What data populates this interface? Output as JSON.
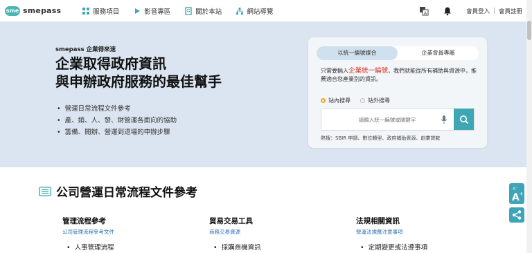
{
  "header": {
    "logo_badge": "sme",
    "logo_text": "smepass",
    "nav": [
      {
        "icon": "grid-icon",
        "label": "服務項目"
      },
      {
        "icon": "play-icon",
        "label": "影音專區"
      },
      {
        "icon": "building-icon",
        "label": "關於本站"
      },
      {
        "icon": "sitemap-icon",
        "label": "網站導覽"
      }
    ],
    "login": "會員登入",
    "register": "會員註冊"
  },
  "hero": {
    "tag": "smepass 企業得來速",
    "title_line1": "企業取得政府資訊",
    "title_line2": "與申辦政府服務的最佳幫手",
    "bullets": [
      "營運日常流程文件參考",
      "產、銷、人、發、財營運各面向的協助",
      "籌備、開辦、營運到退場的申辦步驟"
    ]
  },
  "search_card": {
    "tab_active": "以統一編號媒合",
    "tab_other": "企業會員專屬",
    "desc_prefix": "只需要輸入",
    "desc_highlight": "企業統一編號",
    "desc_suffix": "，我們就能從所有補助與資源中，推薦適合您產業別的資訊。",
    "radio_on": "站內搜尋",
    "radio_off": "站外搜尋",
    "placeholder": "請輸入統一編號或關鍵字",
    "hot_label": "熱搜：SBIR 申請、數位轉型、政府補助資源、創業貸款"
  },
  "section": {
    "title": "公司營運日常流程文件參考",
    "columns": [
      {
        "heading": "管理流程參考",
        "sub": "公司管理流程參考文件",
        "item": "人事管理流程"
      },
      {
        "heading": "貿易交易工具",
        "sub": "商務交易資源",
        "item": "採購商機資訊"
      },
      {
        "heading": "法規相關資訊",
        "sub": "營運法規應注意事項",
        "item": "定期變更或法遵事項"
      }
    ]
  },
  "accent_color": "#3fa7b4",
  "highlight_color": "#d8342c"
}
